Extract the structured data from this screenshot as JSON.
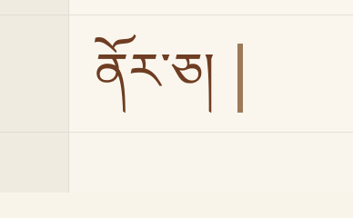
{
  "editor": {
    "text": "ནོར་ཅ།",
    "colors": {
      "text": "#6e3d22",
      "caret": "#9b7a59",
      "background": "#faf6ee",
      "gutter": "#efebe1"
    }
  }
}
